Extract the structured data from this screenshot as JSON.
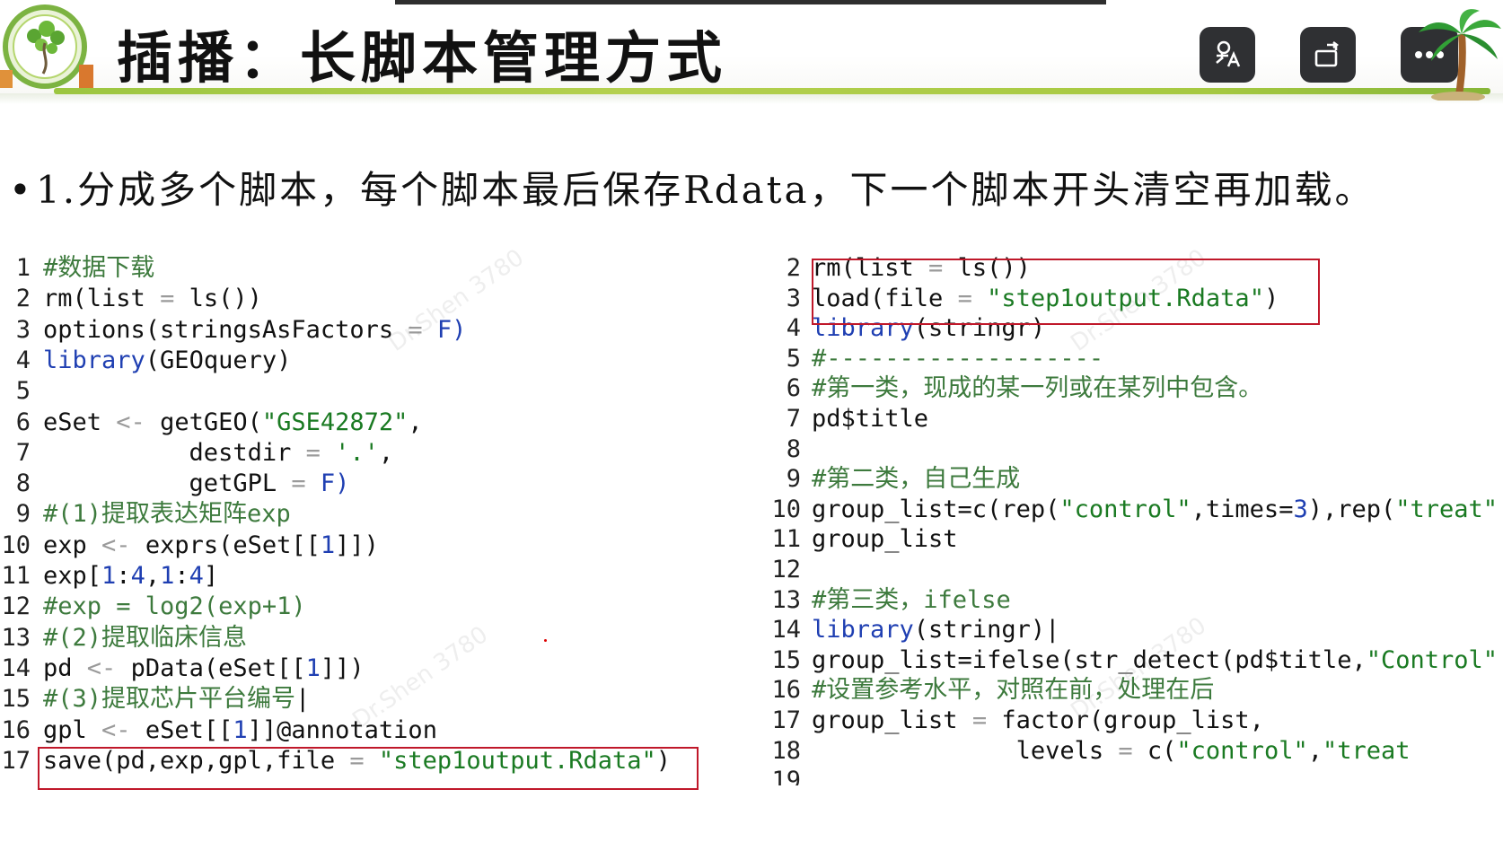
{
  "header": {
    "title": "插播：长脚本管理方式",
    "logo_icon": "tree-logo-icon",
    "buttons": [
      {
        "name": "translate-button",
        "icon": "translate-icon"
      },
      {
        "name": "rotate-button",
        "icon": "rotate-screen-icon"
      },
      {
        "name": "more-button",
        "icon": "more-dots-icon",
        "label": "•••"
      }
    ]
  },
  "bullet": {
    "marker": "•",
    "text": "1.分成多个脚本，每个脚本最后保存Rdata，下一个脚本开头清空再加载。"
  },
  "watermark": "Dr.Shen 3780",
  "left_code": [
    {
      "n": "1",
      "tokens": [
        {
          "t": "#数据下载",
          "c": "comment"
        }
      ]
    },
    {
      "n": "2",
      "tokens": [
        {
          "t": "rm(",
          "c": "plain"
        },
        {
          "t": "list",
          "c": "plain"
        },
        {
          "t": " = ",
          "c": "op"
        },
        {
          "t": "ls())",
          "c": "plain"
        }
      ]
    },
    {
      "n": "3",
      "tokens": [
        {
          "t": "options(stringsAsFactors",
          "c": "plain"
        },
        {
          "t": " = ",
          "c": "op"
        },
        {
          "t": "F)",
          "c": "kw"
        }
      ]
    },
    {
      "n": "4",
      "tokens": [
        {
          "t": "library",
          "c": "kw"
        },
        {
          "t": "(GEOquery)",
          "c": "plain"
        }
      ]
    },
    {
      "n": "5",
      "tokens": []
    },
    {
      "n": "6",
      "tokens": [
        {
          "t": "eSet ",
          "c": "plain"
        },
        {
          "t": "<- ",
          "c": "op"
        },
        {
          "t": "getGEO(",
          "c": "plain"
        },
        {
          "t": "\"GSE42872\"",
          "c": "str"
        },
        {
          "t": ",",
          "c": "plain"
        }
      ]
    },
    {
      "n": "7",
      "tokens": [
        {
          "t": "          destdir",
          "c": "plain"
        },
        {
          "t": " = ",
          "c": "op"
        },
        {
          "t": "'.'",
          "c": "str"
        },
        {
          "t": ",",
          "c": "plain"
        }
      ]
    },
    {
      "n": "8",
      "tokens": [
        {
          "t": "          getGPL",
          "c": "plain"
        },
        {
          "t": " = ",
          "c": "op"
        },
        {
          "t": "F)",
          "c": "kw"
        }
      ]
    },
    {
      "n": "9",
      "tokens": [
        {
          "t": "#(1)提取表达矩阵exp",
          "c": "comment"
        }
      ]
    },
    {
      "n": "10",
      "tokens": [
        {
          "t": "exp ",
          "c": "plain"
        },
        {
          "t": "<- ",
          "c": "op"
        },
        {
          "t": "exprs(eSet[[",
          "c": "plain"
        },
        {
          "t": "1",
          "c": "kw"
        },
        {
          "t": "]])",
          "c": "plain"
        }
      ]
    },
    {
      "n": "11",
      "tokens": [
        {
          "t": "exp[",
          "c": "plain"
        },
        {
          "t": "1",
          "c": "kw"
        },
        {
          "t": ":",
          "c": "plain"
        },
        {
          "t": "4",
          "c": "kw"
        },
        {
          "t": ",",
          "c": "plain"
        },
        {
          "t": "1",
          "c": "kw"
        },
        {
          "t": ":",
          "c": "plain"
        },
        {
          "t": "4",
          "c": "kw"
        },
        {
          "t": "]",
          "c": "plain"
        }
      ]
    },
    {
      "n": "12",
      "tokens": [
        {
          "t": "#exp = log2(exp+1)",
          "c": "comment"
        }
      ]
    },
    {
      "n": "13",
      "tokens": [
        {
          "t": "#(2)提取临床信息",
          "c": "comment"
        }
      ]
    },
    {
      "n": "14",
      "tokens": [
        {
          "t": "pd ",
          "c": "plain"
        },
        {
          "t": "<- ",
          "c": "op"
        },
        {
          "t": "pData(eSet[[",
          "c": "plain"
        },
        {
          "t": "1",
          "c": "kw"
        },
        {
          "t": "]])",
          "c": "plain"
        }
      ]
    },
    {
      "n": "15",
      "tokens": [
        {
          "t": "#(3)提取芯片平台编号",
          "c": "comment"
        },
        {
          "t": "|",
          "c": "plain"
        }
      ]
    },
    {
      "n": "16",
      "tokens": [
        {
          "t": "gpl ",
          "c": "plain"
        },
        {
          "t": "<- ",
          "c": "op"
        },
        {
          "t": "eSet[[",
          "c": "plain"
        },
        {
          "t": "1",
          "c": "kw"
        },
        {
          "t": "]]@annotation",
          "c": "plain"
        }
      ]
    },
    {
      "n": "17",
      "tokens": [
        {
          "t": "save(pd,exp,gpl,file",
          "c": "plain"
        },
        {
          "t": " = ",
          "c": "op"
        },
        {
          "t": "\"step1output.Rdata\"",
          "c": "str"
        },
        {
          "t": ")",
          "c": "plain"
        }
      ]
    }
  ],
  "right_code": [
    {
      "n": "2",
      "tokens": [
        {
          "t": "rm(list",
          "c": "plain"
        },
        {
          "t": " = ",
          "c": "op"
        },
        {
          "t": "ls())",
          "c": "plain"
        }
      ]
    },
    {
      "n": "3",
      "tokens": [
        {
          "t": "load(file",
          "c": "plain"
        },
        {
          "t": " = ",
          "c": "op"
        },
        {
          "t": "\"step1output.Rdata\"",
          "c": "str"
        },
        {
          "t": ")",
          "c": "plain"
        }
      ]
    },
    {
      "n": "4",
      "tokens": [
        {
          "t": "library",
          "c": "kw"
        },
        {
          "t": "(stringr)",
          "c": "plain"
        }
      ]
    },
    {
      "n": "5",
      "tokens": [
        {
          "t": "#-------------------",
          "c": "comment"
        }
      ]
    },
    {
      "n": "6",
      "tokens": [
        {
          "t": "#第一类，现成的某一列或在某列中包含。",
          "c": "comment"
        }
      ]
    },
    {
      "n": "7",
      "tokens": [
        {
          "t": "pd$title",
          "c": "plain"
        }
      ]
    },
    {
      "n": "8",
      "tokens": []
    },
    {
      "n": "9",
      "tokens": [
        {
          "t": "#第二类，自己生成",
          "c": "comment"
        }
      ]
    },
    {
      "n": "10",
      "tokens": [
        {
          "t": "group_list=c(rep(",
          "c": "plain"
        },
        {
          "t": "\"control\"",
          "c": "str"
        },
        {
          "t": ",times=",
          "c": "plain"
        },
        {
          "t": "3",
          "c": "kw"
        },
        {
          "t": "),rep(",
          "c": "plain"
        },
        {
          "t": "\"treat\"",
          "c": "str"
        }
      ]
    },
    {
      "n": "11",
      "tokens": [
        {
          "t": "group_list",
          "c": "plain"
        }
      ]
    },
    {
      "n": "12",
      "tokens": []
    },
    {
      "n": "13",
      "tokens": [
        {
          "t": "#第三类，ifelse",
          "c": "comment"
        }
      ]
    },
    {
      "n": "14",
      "tokens": [
        {
          "t": "library",
          "c": "kw"
        },
        {
          "t": "(stringr)|",
          "c": "plain"
        }
      ]
    },
    {
      "n": "15",
      "tokens": [
        {
          "t": "group_list=ifelse(str_detect(pd$title,",
          "c": "plain"
        },
        {
          "t": "\"Control\"",
          "c": "str"
        }
      ]
    },
    {
      "n": "16",
      "tokens": [
        {
          "t": "#设置参考水平，对照在前，处理在后",
          "c": "comment"
        }
      ]
    },
    {
      "n": "17",
      "tokens": [
        {
          "t": "group_list",
          "c": "plain"
        },
        {
          "t": " = ",
          "c": "op"
        },
        {
          "t": "factor(group_list,",
          "c": "plain"
        }
      ]
    },
    {
      "n": "18",
      "tokens": [
        {
          "t": "              levels",
          "c": "plain"
        },
        {
          "t": " = ",
          "c": "op"
        },
        {
          "t": "c(",
          "c": "plain"
        },
        {
          "t": "\"control\"",
          "c": "str"
        },
        {
          "t": ",",
          "c": "plain"
        },
        {
          "t": "\"treat",
          "c": "str"
        }
      ]
    },
    {
      "n": "19",
      "tokens": []
    }
  ],
  "colors": {
    "string": "#1a7a22",
    "comment": "#3d7a3d",
    "keyword": "#1f3fb2",
    "highlight_border": "#c0182a",
    "toolbar_button": "#2f3033",
    "header_rule": "#9cc641"
  }
}
